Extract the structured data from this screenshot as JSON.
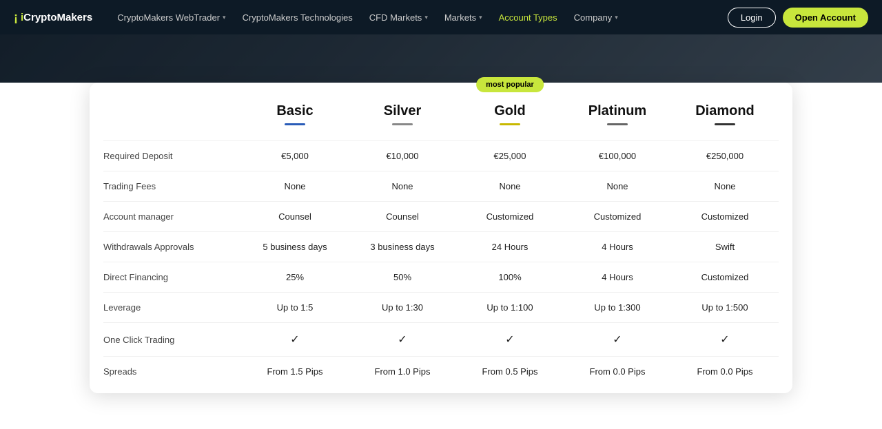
{
  "navbar": {
    "logo_icon": "¡",
    "logo_text1": "i",
    "logo_text2": "CryptoMakers",
    "items": [
      {
        "label": "CryptoMakers WebTrader",
        "has_dropdown": true
      },
      {
        "label": "CryptoMakers Technologies",
        "has_dropdown": false
      },
      {
        "label": "CFD Markets",
        "has_dropdown": true
      },
      {
        "label": "Markets",
        "has_dropdown": true
      },
      {
        "label": "Account Types",
        "has_dropdown": false,
        "active": true
      },
      {
        "label": "Company",
        "has_dropdown": true
      }
    ],
    "login_label": "Login",
    "open_account_label": "Open Account"
  },
  "pricing": {
    "most_popular_badge": "most popular",
    "plans": [
      {
        "name": "Basic",
        "underline_class": "blue"
      },
      {
        "name": "Silver",
        "underline_class": "silver"
      },
      {
        "name": "Gold",
        "underline_class": "gold"
      },
      {
        "name": "Platinum",
        "underline_class": "plat"
      },
      {
        "name": "Diamond",
        "underline_class": "diamond"
      }
    ],
    "rows": [
      {
        "feature": "Required Deposit",
        "values": [
          "€5,000",
          "€10,000",
          "€25,000",
          "€100,000",
          "€250,000"
        ]
      },
      {
        "feature": "Trading Fees",
        "values": [
          "None",
          "None",
          "None",
          "None",
          "None"
        ]
      },
      {
        "feature": "Account manager",
        "values": [
          "Counsel",
          "Counsel",
          "Customized",
          "Customized",
          "Customized"
        ]
      },
      {
        "feature": "Withdrawals Approvals",
        "values": [
          "5 business days",
          "3 business days",
          "24 Hours",
          "4 Hours",
          "Swift"
        ]
      },
      {
        "feature": "Direct Financing",
        "values": [
          "25%",
          "50%",
          "100%",
          "4 Hours",
          "Customized"
        ]
      },
      {
        "feature": "Leverage",
        "values": [
          "Up to 1:5",
          "Up to 1:30",
          "Up to 1:100",
          "Up to 1:300",
          "Up to 1:500"
        ]
      },
      {
        "feature": "One Click Trading",
        "values": [
          "✓",
          "✓",
          "✓",
          "✓",
          "✓"
        ]
      },
      {
        "feature": "Spreads",
        "values": [
          "From 1.5 Pips",
          "From 1.0 Pips",
          "From 0.5 Pips",
          "From 0.0 Pips",
          "From 0.0 Pips"
        ]
      }
    ]
  }
}
